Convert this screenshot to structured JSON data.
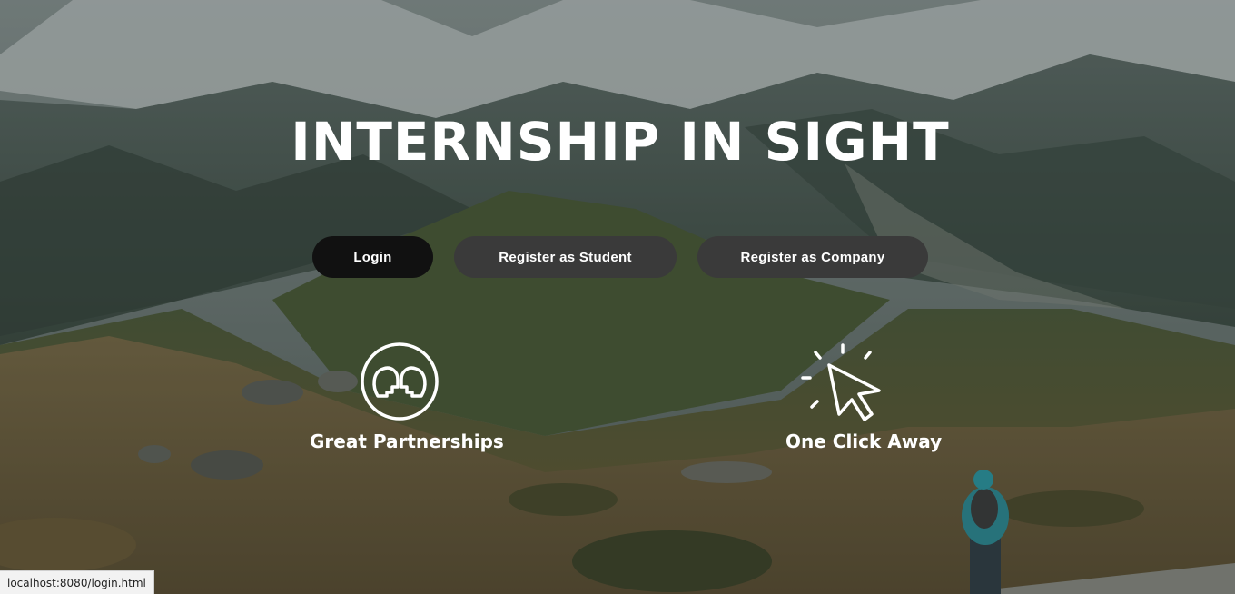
{
  "hero": {
    "title": "INTERNSHIP IN SIGHT"
  },
  "buttons": {
    "login": "Login",
    "register_student": "Register as Student",
    "register_company": "Register as Company"
  },
  "features": [
    {
      "label": "Great Partnerships",
      "icon": "partnership-heads-icon"
    },
    {
      "label": "One Click Away",
      "icon": "cursor-click-icon"
    }
  ],
  "status_bar": {
    "url": "localhost:8080/login.html"
  },
  "colors": {
    "login_button": "#111111",
    "register_button": "#3a3a3a",
    "text": "#ffffff"
  }
}
